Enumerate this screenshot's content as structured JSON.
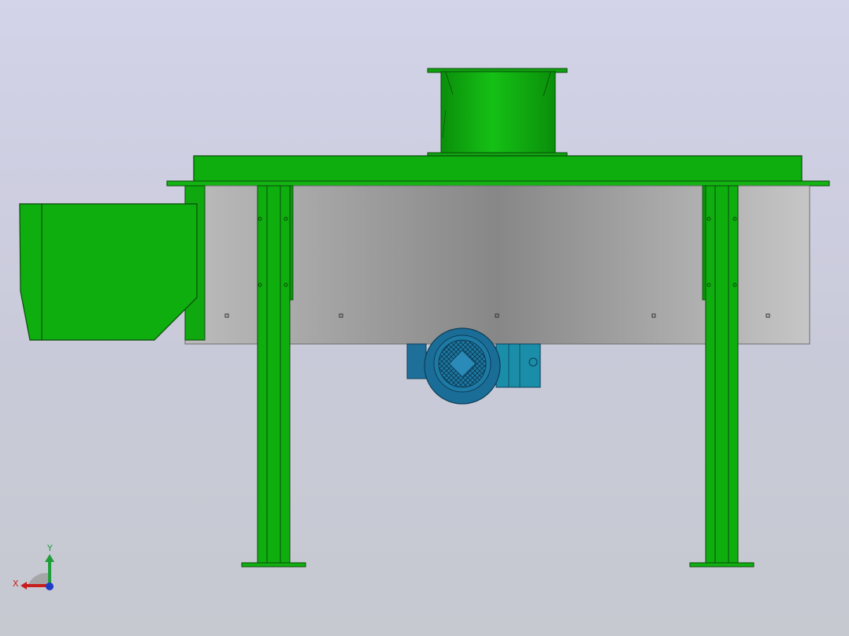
{
  "viewport": {
    "background_top": "#d3d3e9",
    "background_bottom": "#c6c9d0"
  },
  "model": {
    "frame_color": "#0da80d",
    "frame_edge_color": "#0a4a0a",
    "housing_color": "#9a9a9a",
    "motor_color": "#1a7fa3"
  },
  "triad": {
    "x_label": "X",
    "y_label": "Y",
    "x_color": "#c81e1e",
    "y_color": "#1e9e3a",
    "z_color": "#1e3cc8"
  }
}
